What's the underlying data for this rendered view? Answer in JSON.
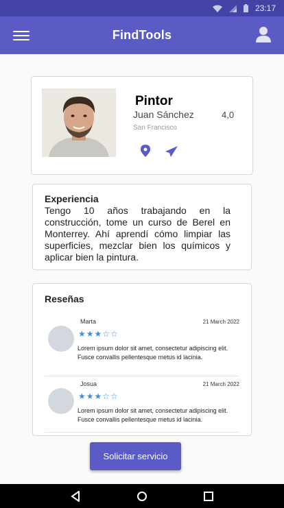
{
  "status_bar": {
    "time": "23:17",
    "icons": [
      "wifi-icon",
      "signal-icon",
      "battery-icon"
    ]
  },
  "app_bar": {
    "title": "FindTools",
    "menu_icon": "hamburger-menu-icon",
    "profile_icon": "account-icon"
  },
  "profile": {
    "trade": "Pintor",
    "name": "Juan Sánchez",
    "rating": "4,0",
    "city": "San Francisco",
    "actions": [
      "location-pin-icon",
      "send-icon"
    ]
  },
  "experience": {
    "title": "Experiencia",
    "text": "Tengo 10 años trabajando en la construcción, tome un curso de Berel en Monterrey. Ahí aprendí cómo limpiar las superficies, mezclar bien los químicos y aplicar bien la pintura."
  },
  "reviews": {
    "title": "Reseñas",
    "items": [
      {
        "name": "Marta",
        "date": "21 March 2022",
        "stars_filled": 3,
        "stars_total": 5,
        "text": "Lorem ipsum dolor sit amet, consectetur adipiscing elit. Fusce convallis pellentesque metus id lacinia."
      },
      {
        "name": "Josua",
        "date": "21 March 2022",
        "stars_filled": 3,
        "stars_total": 5,
        "text": "Lorem ipsum dolor sit amet, consectetur adipiscing elit. Fusce convallis pellentesque metus id lacinia."
      }
    ]
  },
  "cta": {
    "label": "Solicitar servicio"
  },
  "nav_bar": {
    "icons": [
      "back-icon",
      "home-icon",
      "recents-icon"
    ]
  },
  "colors": {
    "primary": "#5b5bc6",
    "status_bar": "#4343a5",
    "star": "#3f8fd6"
  }
}
